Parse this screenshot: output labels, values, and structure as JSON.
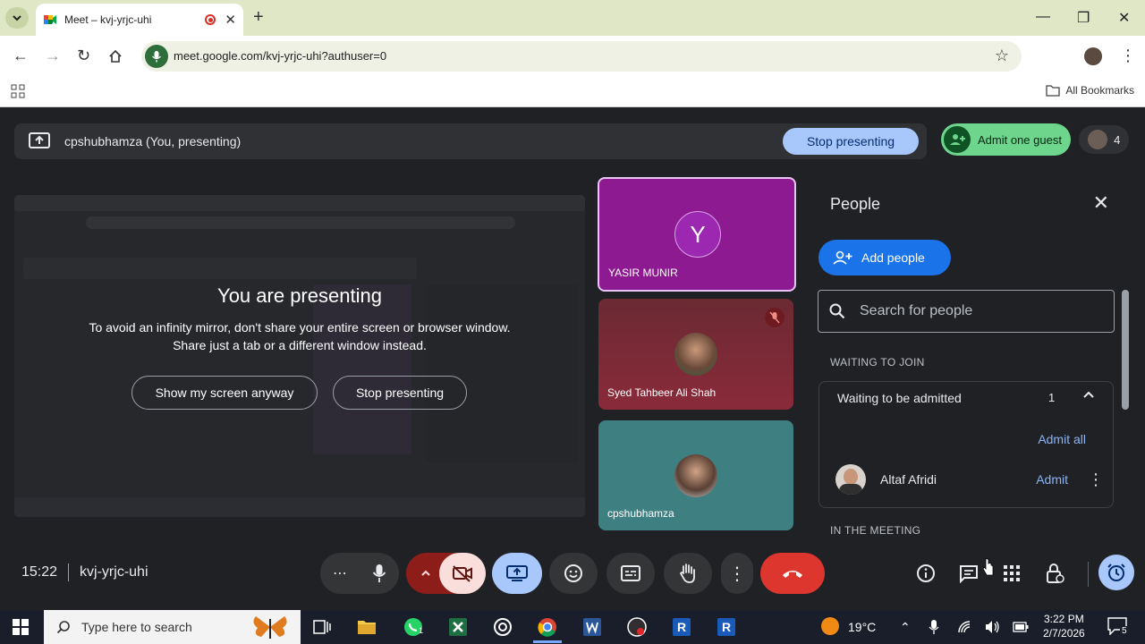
{
  "browser": {
    "tab_title": "Meet – kvj-yrjc-uhi",
    "url": "meet.google.com/kvj-yrjc-uhi?authuser=0",
    "bookmarks_label": "All Bookmarks"
  },
  "meet": {
    "present_bar_label": "cpshubhamza (You, presenting)",
    "stop_presenting_label": "Stop presenting",
    "admit_guest_label": "Admit one guest",
    "participant_count": "4",
    "overlay": {
      "heading": "You are presenting",
      "message_line1": "To avoid an infinity mirror, don't share your entire screen or browser window.",
      "message_line2": "Share just a tab or a different window instead.",
      "show_anyway_label": "Show my screen anyway",
      "stop_label": "Stop presenting"
    },
    "tiles": [
      {
        "name": "YASIR MUNIR",
        "initial": "Y"
      },
      {
        "name": "Syed Tahbeer Ali Shah"
      },
      {
        "name": "cpshubhamza"
      }
    ],
    "people_panel": {
      "title": "People",
      "add_people_label": "Add people",
      "search_placeholder": "Search for people",
      "waiting_section": "WAITING TO JOIN",
      "waiting_header": "Waiting to be admitted",
      "waiting_count": "1",
      "admit_all_label": "Admit all",
      "waiting_person": "Altaf Afridi",
      "admit_label": "Admit",
      "in_meeting_section": "IN THE MEETING"
    },
    "time": "15:22",
    "meeting_code": "kvj-yrjc-uhi"
  },
  "taskbar": {
    "search_placeholder": "Type here to search",
    "temperature": "19°C",
    "clock_time": "3:22 PM",
    "clock_date": "2/7/2026",
    "notification_count": "5",
    "whatsapp_badge": "1"
  },
  "colors": {
    "accent_blue": "#1a73e8",
    "admit_green": "#6dd58c",
    "end_call_red": "#dc362e",
    "stop_presenting_bg": "#a8c7fa"
  }
}
